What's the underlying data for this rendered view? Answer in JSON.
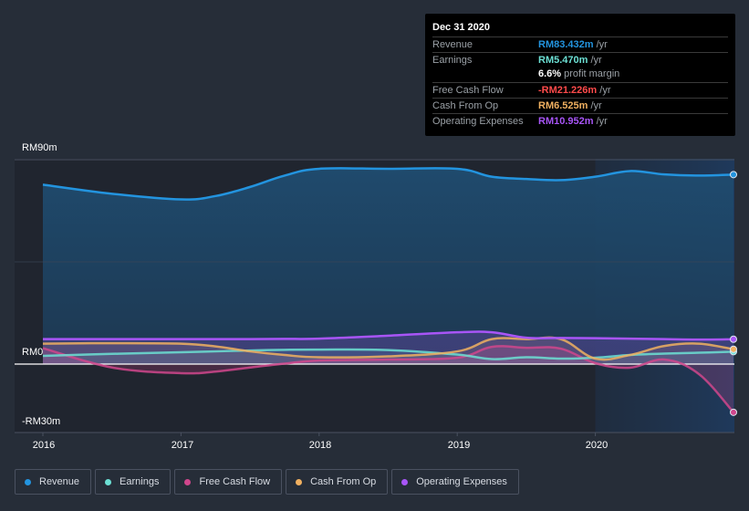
{
  "tooltip": {
    "date": "Dec 31 2020",
    "rows": [
      {
        "label": "Revenue",
        "value": "RM83.432m",
        "unit": " /yr",
        "color": "#2394df"
      },
      {
        "label": "Earnings",
        "value": "RM5.470m",
        "unit": " /yr",
        "color": "#6ce0d4"
      },
      {
        "label": "",
        "value": "6.6%",
        "unit": " profit margin",
        "color": "#ffffff"
      },
      {
        "label": "Free Cash Flow",
        "value": "-RM21.226m",
        "unit": " /yr",
        "color": "#ff4b4b"
      },
      {
        "label": "Cash From Op",
        "value": "RM6.525m",
        "unit": " /yr",
        "color": "#f0b060"
      },
      {
        "label": "Operating Expenses",
        "value": "RM10.952m",
        "unit": " /yr",
        "color": "#a855f7"
      }
    ]
  },
  "legend": [
    {
      "label": "Revenue",
      "color": "#2394df"
    },
    {
      "label": "Earnings",
      "color": "#6ce0d4"
    },
    {
      "label": "Free Cash Flow",
      "color": "#d0468c"
    },
    {
      "label": "Cash From Op",
      "color": "#f0b060"
    },
    {
      "label": "Operating Expenses",
      "color": "#a855f7"
    }
  ],
  "chart_data": {
    "type": "line",
    "title": "",
    "xlabel": "",
    "ylabel": "",
    "x_ticks": [
      "2016",
      "2017",
      "2018",
      "2019",
      "2020"
    ],
    "y_ticks": [
      "RM90m",
      "RM0",
      "-RM30m"
    ],
    "y_tick_values": [
      90,
      0,
      -30
    ],
    "ylim": [
      -30,
      90
    ],
    "xlim": [
      2016.0,
      2021.0
    ],
    "grid": true,
    "legend_position": "bottom",
    "units": "RM millions",
    "highlight_region": {
      "from": 2020.0,
      "to": 2021.0,
      "label": "Dec 31 2020"
    },
    "x": [
      2016.0,
      2016.5,
      2017.0,
      2017.25,
      2017.5,
      2017.75,
      2018.0,
      2018.5,
      2019.0,
      2019.25,
      2019.5,
      2019.75,
      2020.0,
      2020.25,
      2020.5,
      2020.75,
      2021.0
    ],
    "series": [
      {
        "name": "Revenue",
        "color": "#2394df",
        "values": [
          79,
          75,
          72.5,
          74,
          78,
          83,
          86,
          86,
          86,
          82.5,
          81.5,
          81,
          82.5,
          85,
          83.5,
          83,
          83.432
        ]
      },
      {
        "name": "Earnings",
        "color": "#6ce0d4",
        "values": [
          3.6,
          4.5,
          5.2,
          5.6,
          6.0,
          6.3,
          6.4,
          6.2,
          4.2,
          2.2,
          3.0,
          2.4,
          2.8,
          4.0,
          4.6,
          5.0,
          5.47
        ]
      },
      {
        "name": "Free Cash Flow",
        "color": "#d0468c",
        "values": [
          7,
          -1.5,
          -4,
          -3.3,
          -1.5,
          0.2,
          1.6,
          2.0,
          2.8,
          7.6,
          7.2,
          6.8,
          0.4,
          -1.6,
          2.0,
          -4.4,
          -21.226
        ]
      },
      {
        "name": "Cash From Op",
        "color": "#f0b060",
        "values": [
          9,
          9.2,
          9.0,
          7.8,
          5.6,
          4.0,
          3.0,
          3.4,
          5.6,
          11,
          11,
          11,
          2.4,
          4.0,
          8.0,
          9.0,
          6.525
        ]
      },
      {
        "name": "Operating Expenses",
        "color": "#a855f7",
        "values": [
          11,
          11,
          11,
          11,
          11,
          11.1,
          11.2,
          12.5,
          14,
          14,
          11.6,
          11.5,
          11.4,
          11.2,
          11.0,
          10.8,
          10.952
        ]
      }
    ]
  }
}
